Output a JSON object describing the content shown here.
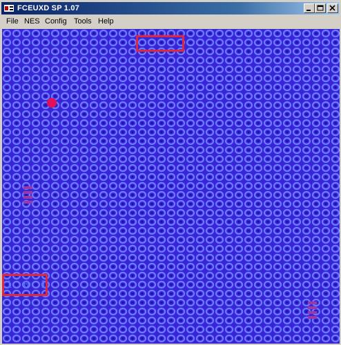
{
  "window": {
    "title": "FCEUXD SP 1.07",
    "controls": {
      "minimize": "minimize-icon",
      "maximize": "maximize-icon",
      "close": "close-icon"
    }
  },
  "menu": {
    "items": [
      {
        "label": "File"
      },
      {
        "label": "NES"
      },
      {
        "label": "Config"
      },
      {
        "label": "Tools"
      },
      {
        "label": "Help"
      }
    ]
  },
  "game": {
    "hud_bottom_text": "1 0 1",
    "colors": {
      "background": "#3a24d8",
      "pattern_light": "#6a7cff",
      "pattern_dark": "#2412b0",
      "hud_border": "#e0283c",
      "player": "#e0105a",
      "enemy": "#9a3aa8"
    }
  }
}
